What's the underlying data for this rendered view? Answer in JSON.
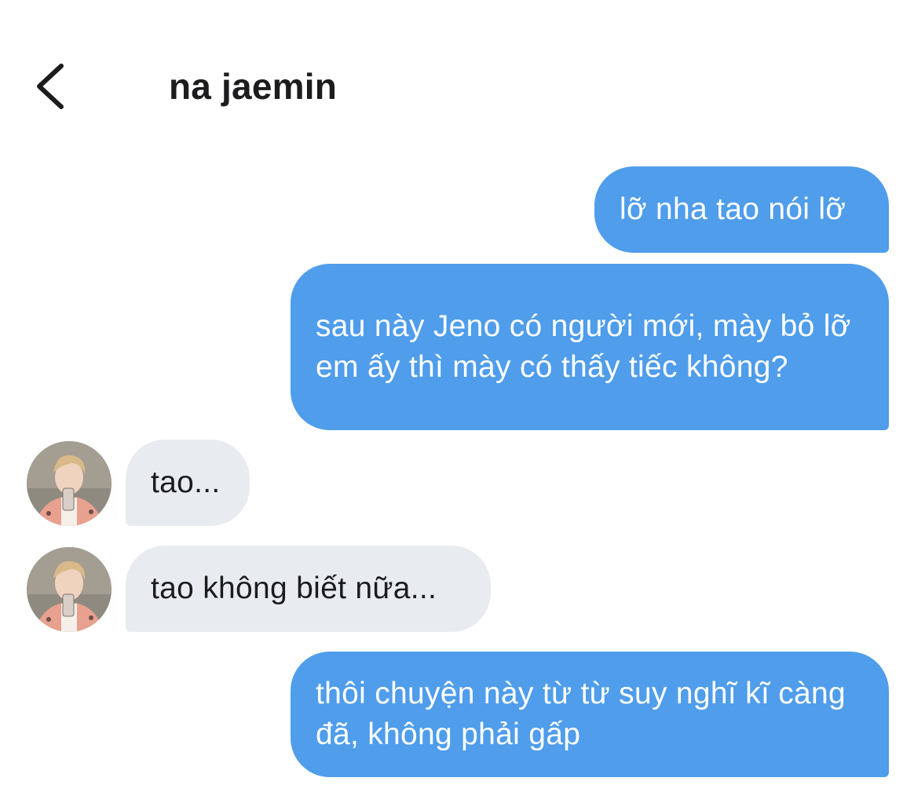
{
  "header": {
    "title": "na jaemin",
    "back_icon": "chevron-left-icon"
  },
  "colors": {
    "outgoing_bubble": "#4f9deb",
    "incoming_bubble": "#e8ecf0",
    "outgoing_text": "#ffffff",
    "incoming_text": "#1c1c1e",
    "background": "#ffffff"
  },
  "messages": [
    {
      "direction": "outgoing",
      "text": "lỡ nha tao nói lỡ"
    },
    {
      "direction": "outgoing",
      "text": "sau này Jeno có người mới, mày bỏ lỡ em ấy thì mày có thấy tiếc không?"
    },
    {
      "direction": "incoming",
      "text": "tao...",
      "avatar": "contact-avatar"
    },
    {
      "direction": "incoming",
      "text": "tao không biết nữa...",
      "avatar": "contact-avatar"
    },
    {
      "direction": "outgoing",
      "text": "thôi chuyện này từ từ suy nghĩ kĩ càng đã, không phải gấp"
    }
  ]
}
